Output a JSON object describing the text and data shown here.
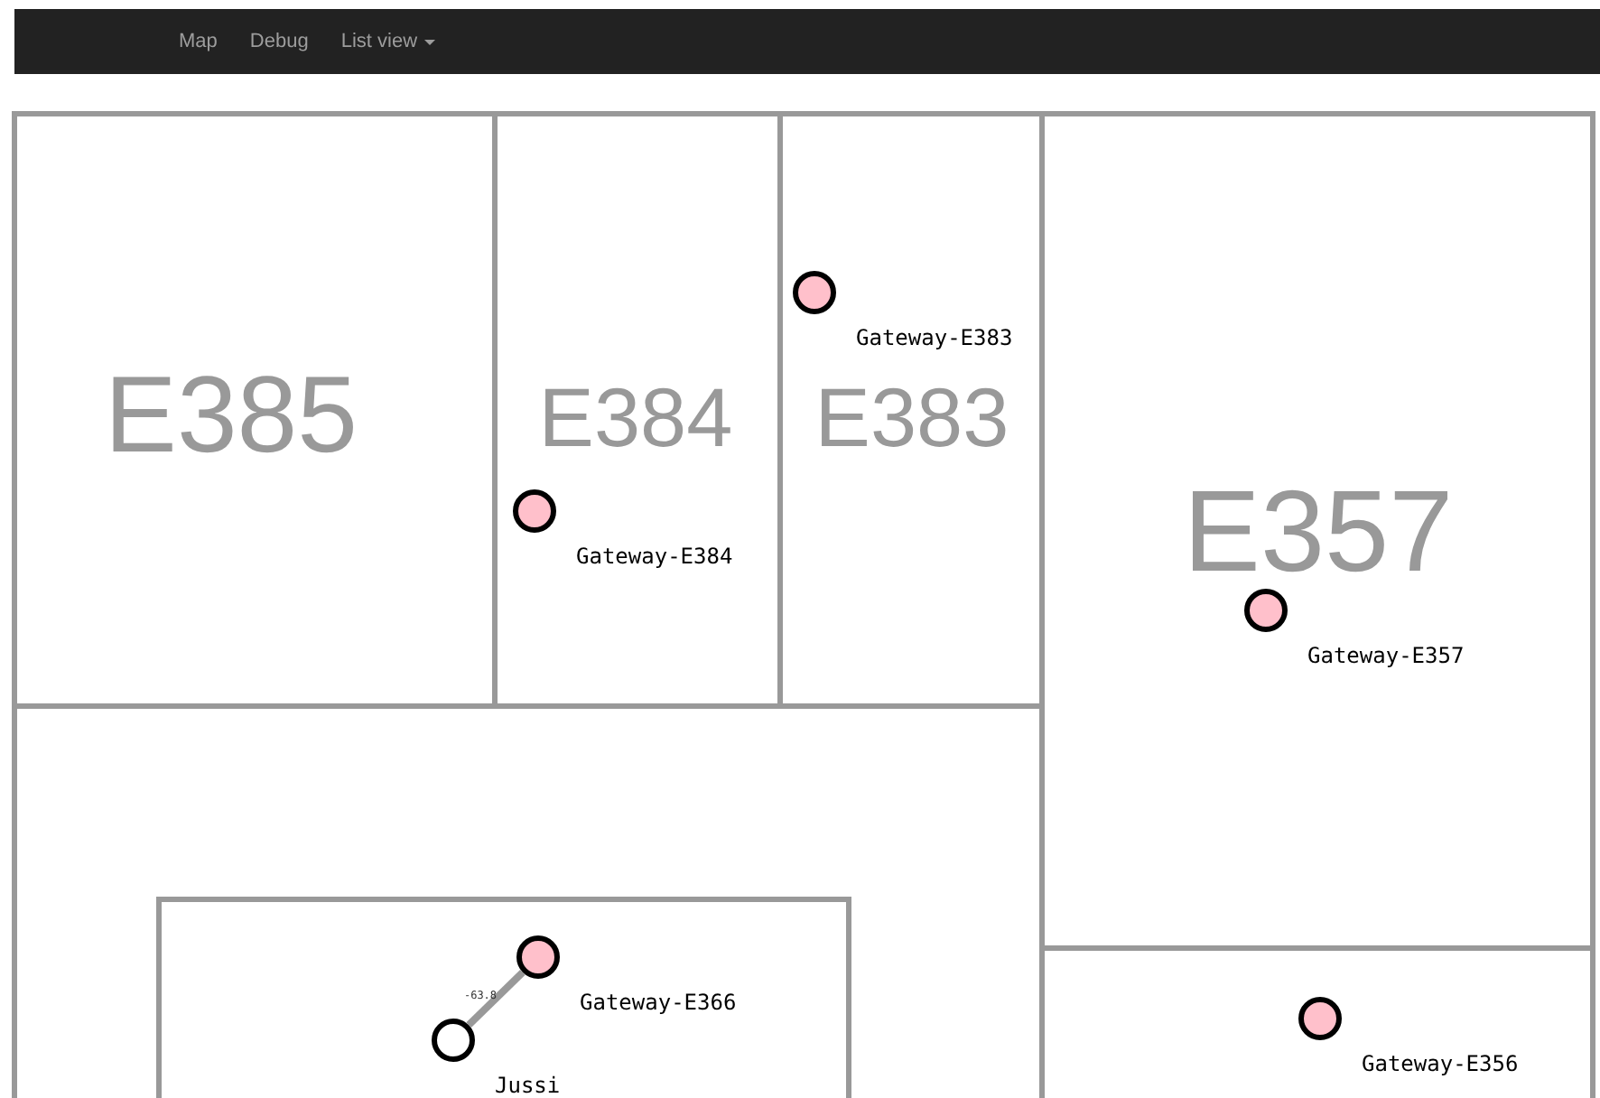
{
  "nav": [
    {
      "label": "Map",
      "kind": "link"
    },
    {
      "label": "Debug",
      "kind": "link"
    },
    {
      "label": "List view",
      "kind": "dropdown"
    }
  ],
  "rooms": [
    {
      "name": "E385"
    },
    {
      "name": "E384"
    },
    {
      "name": "E383"
    },
    {
      "name": "E357"
    }
  ],
  "nodes": [
    {
      "label": "Gateway-E383",
      "kind": "gateway"
    },
    {
      "label": "Gateway-E384",
      "kind": "gateway"
    },
    {
      "label": "Gateway-E357",
      "kind": "gateway"
    },
    {
      "label": "Gateway-E366",
      "kind": "gateway"
    },
    {
      "label": "Jussi",
      "kind": "user"
    },
    {
      "label": "Gateway-E356",
      "kind": "gateway"
    }
  ],
  "links": [
    {
      "label": "-63.8"
    }
  ]
}
